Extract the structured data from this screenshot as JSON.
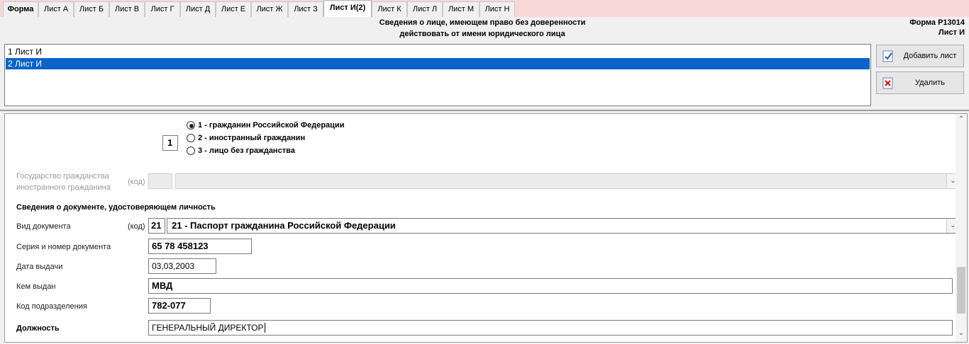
{
  "tabs": [
    "Форма",
    "Лист А",
    "Лист Б",
    "Лист В",
    "Лист Г",
    "Лист Д",
    "Лист Е",
    "Лист Ж",
    "Лист З",
    "Лист И(2)",
    "Лист К",
    "Лист Л",
    "Лист М",
    "Лист Н"
  ],
  "header": {
    "title_line1": "Сведения о лице, имеющем право без доверенности",
    "title_line2": "действовать от имени юридического лица",
    "form_code": "Форма Р13014",
    "sheet": "Лист И"
  },
  "sheets_list": [
    "1 Лист И",
    "2 Лист И"
  ],
  "buttons": {
    "add": "Добавить лист",
    "delete": "Удалить"
  },
  "citizenship": {
    "code": "1",
    "options": [
      "1 - гражданин Российской Федерации",
      "2 - иностранный гражданин",
      "3 - лицо без гражданства"
    ],
    "selected_index": 0
  },
  "foreign_state": {
    "label_line1": "Государство гражданства",
    "label_line2": "иностранного гражданина",
    "code_label": "(код)",
    "code": "",
    "value": ""
  },
  "document_section_title": "Сведения о документе, удостоверяющем личность",
  "document": {
    "type_label": "Вид документа",
    "code_label": "(код)",
    "type_code": "21",
    "type_value": "21 - Паспорт гражданина Российской Федерации",
    "series_label": "Серия и номер документа",
    "series_value": "65 78 458123",
    "date_label": "Дата выдачи",
    "date_value": "03,03,2003",
    "issuer_label": "Кем выдан",
    "issuer_value": "МВД",
    "division_label": "Код подразделения",
    "division_value": "782-077"
  },
  "position": {
    "label": "Должность",
    "value": "ГЕНЕРАЛЬНЫЙ ДИРЕКТОР"
  },
  "icons": {
    "add": "document-check-icon",
    "delete": "document-delete-icon",
    "scroll_up": "chevron-up-icon",
    "scroll_down": "chevron-down-icon"
  },
  "colors": {
    "tab_strip": "#f8d7d7",
    "selection": "#0a64c8"
  }
}
